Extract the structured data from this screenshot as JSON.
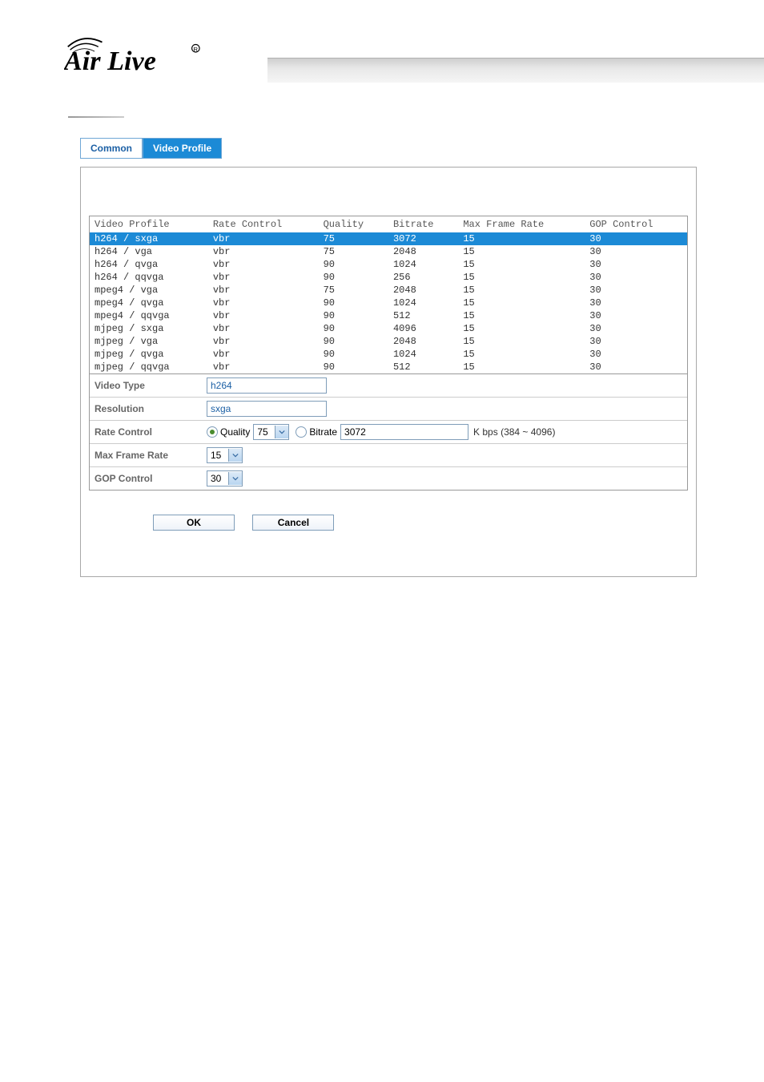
{
  "logo_text": "AirLive",
  "tabs": {
    "common": "Common",
    "video_profile": "Video Profile"
  },
  "table": {
    "headers": {
      "profile": "Video Profile",
      "rate_control": "Rate Control",
      "quality": "Quality",
      "bitrate": "Bitrate",
      "max_frame": "Max Frame Rate",
      "gop": "GOP Control"
    },
    "rows": [
      {
        "profile": "h264 / sxga",
        "rc": "vbr",
        "q": "75",
        "br": "3072",
        "mf": "15",
        "gop": "30",
        "selected": true
      },
      {
        "profile": "h264 / vga",
        "rc": "vbr",
        "q": "75",
        "br": "2048",
        "mf": "15",
        "gop": "30"
      },
      {
        "profile": "h264 / qvga",
        "rc": "vbr",
        "q": "90",
        "br": "1024",
        "mf": "15",
        "gop": "30"
      },
      {
        "profile": "h264 / qqvga",
        "rc": "vbr",
        "q": "90",
        "br": "256",
        "mf": "15",
        "gop": "30"
      },
      {
        "profile": "mpeg4 / vga",
        "rc": "vbr",
        "q": "75",
        "br": "2048",
        "mf": "15",
        "gop": "30"
      },
      {
        "profile": "mpeg4 / qvga",
        "rc": "vbr",
        "q": "90",
        "br": "1024",
        "mf": "15",
        "gop": "30"
      },
      {
        "profile": "mpeg4 / qqvga",
        "rc": "vbr",
        "q": "90",
        "br": "512",
        "mf": "15",
        "gop": "30"
      },
      {
        "profile": "mjpeg / sxga",
        "rc": "vbr",
        "q": "90",
        "br": "4096",
        "mf": "15",
        "gop": "30"
      },
      {
        "profile": "mjpeg / vga",
        "rc": "vbr",
        "q": "90",
        "br": "2048",
        "mf": "15",
        "gop": "30"
      },
      {
        "profile": "mjpeg / qvga",
        "rc": "vbr",
        "q": "90",
        "br": "1024",
        "mf": "15",
        "gop": "30"
      },
      {
        "profile": "mjpeg / qqvga",
        "rc": "vbr",
        "q": "90",
        "br": "512",
        "mf": "15",
        "gop": "30"
      }
    ]
  },
  "form": {
    "video_type_label": "Video Type",
    "video_type_value": "h264",
    "resolution_label": "Resolution",
    "resolution_value": "sxga",
    "rate_control_label": "Rate Control",
    "quality_label": "Quality",
    "quality_value": "75",
    "bitrate_label": "Bitrate",
    "bitrate_value": "3072",
    "bitrate_range": "K bps (384 ~ 4096)",
    "max_frame_label": "Max Frame Rate",
    "max_frame_value": "15",
    "gop_label": "GOP Control",
    "gop_value": "30"
  },
  "buttons": {
    "ok": "OK",
    "cancel": "Cancel"
  }
}
